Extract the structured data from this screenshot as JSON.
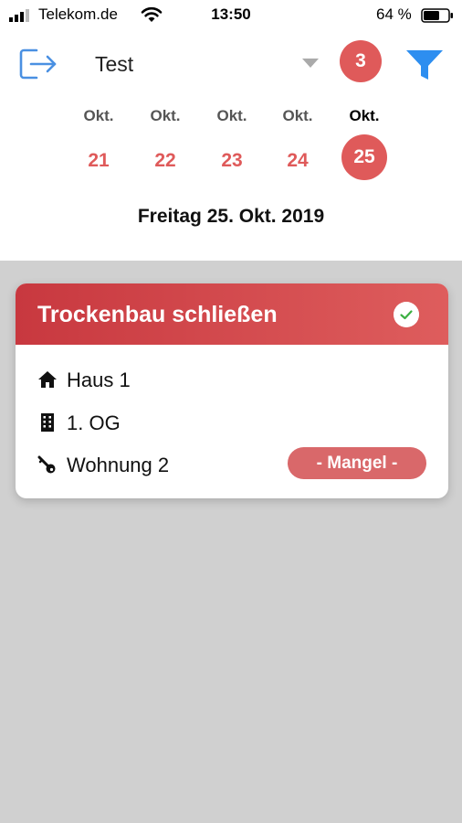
{
  "status_bar": {
    "carrier": "Telekom.de",
    "time": "13:50",
    "battery": "64 %"
  },
  "header": {
    "project": "Test",
    "count": "3"
  },
  "date_strip": {
    "days": [
      {
        "month": "Okt.",
        "day": "21"
      },
      {
        "month": "Okt.",
        "day": "22"
      },
      {
        "month": "Okt.",
        "day": "23"
      },
      {
        "month": "Okt.",
        "day": "24"
      },
      {
        "month": "Okt.",
        "day": "25",
        "selected": true
      }
    ],
    "selected_date": "Freitag 25. Okt. 2019"
  },
  "card": {
    "title": "Trockenbau schließen",
    "building": "Haus 1",
    "floor": "1. OG",
    "unit": "Wohnung 2",
    "tag": "- Mangel -"
  },
  "colors": {
    "accent_red": "#df5a5a",
    "filter_blue": "#2d8ef0",
    "logout_blue": "#4a90e2",
    "background_gray": "#d0d0d0"
  },
  "icons": {
    "logout": "logout-icon",
    "filter": "filter-icon",
    "check": "check-circle-icon",
    "building": "home-icon",
    "floor": "building-icon",
    "unit": "key-icon"
  }
}
